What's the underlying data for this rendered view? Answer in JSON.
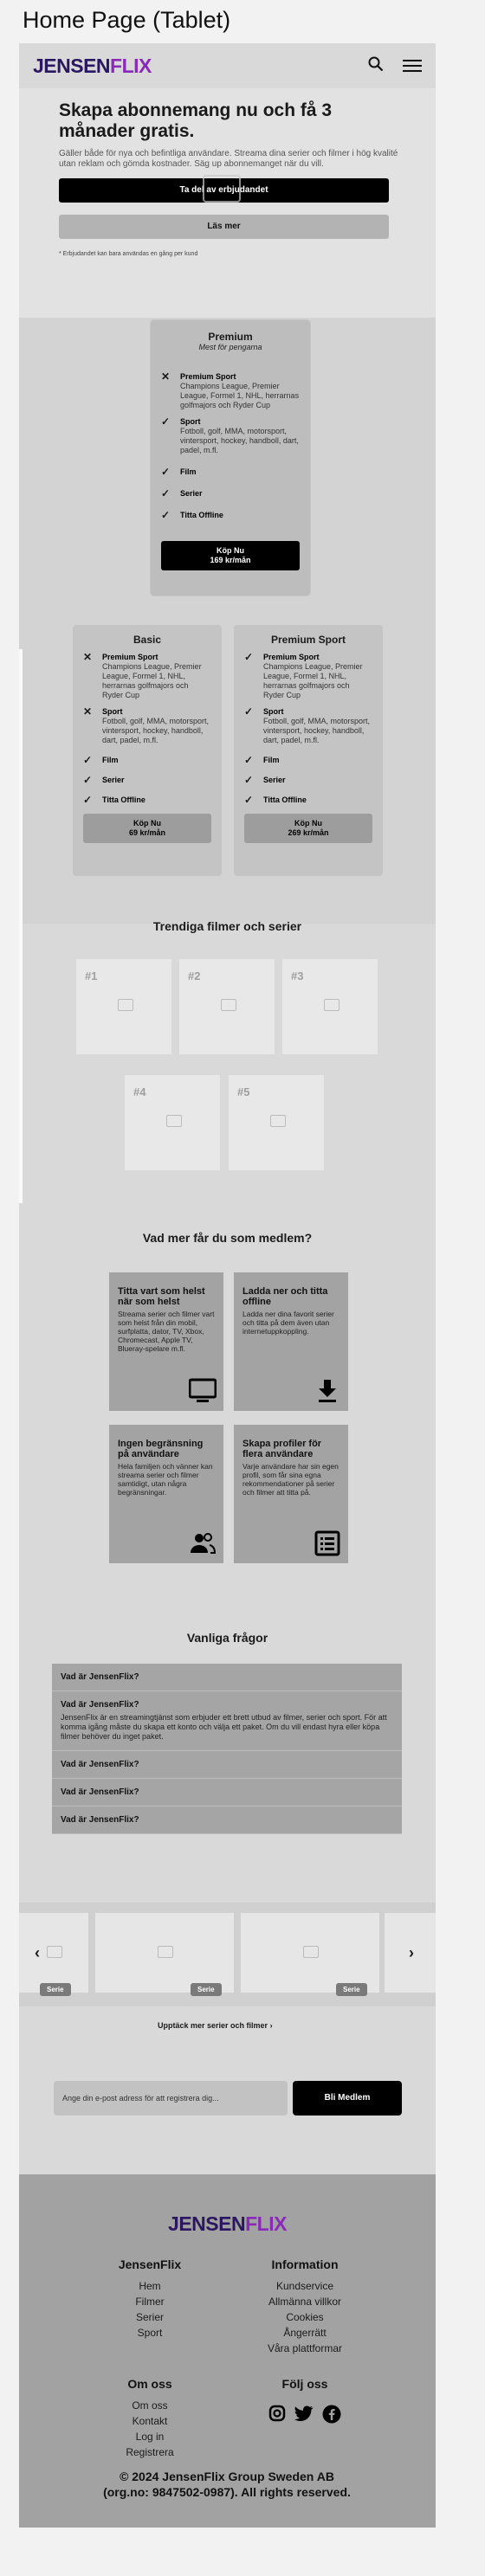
{
  "page_title": "Home Page (Tablet)",
  "header": {
    "logo_part1": "JENSEN",
    "logo_part2": "FLIX",
    "search_icon": "search-icon",
    "menu_icon": "hamburger-icon"
  },
  "hero": {
    "title": "Skapa abonnemang nu och få 3 månader gratis.",
    "subtitle": "Gäller både för nya och befintliga användare. Streama dina serier och filmer i hög kvalité utan reklam och gömda kostnader. Säg up abonnemanget när du vill.",
    "cta_primary": "Ta del av erbjudandet",
    "cta_secondary": "Läs mer",
    "fineprint": "* Erbjudandet kan bara användas en gång per kund"
  },
  "plans": {
    "featured": {
      "name": "Premium",
      "tagline": "Mest för pengarna",
      "features": [
        {
          "icon": "x-icon",
          "mark": "✕",
          "title": "Premium Sport",
          "desc": "Champions League, Premier League, Formel 1, NHL, herrarnas golfmajors och Ryder Cup"
        },
        {
          "icon": "check-icon",
          "mark": "✓",
          "title": "Sport",
          "desc": "Fotboll, golf, MMA, motorsport, vintersport, hockey, handboll, dart, padel, m.fl."
        },
        {
          "icon": "check-icon",
          "mark": "✓",
          "title": "Film",
          "desc": ""
        },
        {
          "icon": "check-icon",
          "mark": "✓",
          "title": "Serier",
          "desc": ""
        },
        {
          "icon": "check-icon",
          "mark": "✓",
          "title": "Titta Offline",
          "desc": ""
        }
      ],
      "button_line1": "Köp Nu",
      "button_line2": "169 kr/mån"
    },
    "basic": {
      "name": "Basic",
      "features": [
        {
          "icon": "x-icon",
          "mark": "✕",
          "title": "Premium Sport",
          "desc": "Champions League, Premier League, Formel 1, NHL, herrarnas golfmajors och Ryder Cup"
        },
        {
          "icon": "x-icon",
          "mark": "✕",
          "title": "Sport",
          "desc": "Fotboll, golf, MMA, motorsport, vintersport, hockey, handboll, dart, padel, m.fl."
        },
        {
          "icon": "check-icon",
          "mark": "✓",
          "title": "Film",
          "desc": ""
        },
        {
          "icon": "check-icon",
          "mark": "✓",
          "title": "Serier",
          "desc": ""
        },
        {
          "icon": "check-icon",
          "mark": "✓",
          "title": "Titta Offline",
          "desc": ""
        }
      ],
      "button_line1": "Köp Nu",
      "button_line2": "69 kr/mån"
    },
    "premium_sport": {
      "name": "Premium Sport",
      "features": [
        {
          "icon": "check-icon",
          "mark": "✓",
          "title": "Premium Sport",
          "desc": "Champions League, Premier League, Formel 1, NHL, herrarnas golfmajors och Ryder Cup"
        },
        {
          "icon": "check-icon",
          "mark": "✓",
          "title": "Sport",
          "desc": "Fotboll, golf, MMA, motorsport, vintersport, hockey, handboll, dart, padel, m.fl."
        },
        {
          "icon": "check-icon",
          "mark": "✓",
          "title": "Film",
          "desc": ""
        },
        {
          "icon": "check-icon",
          "mark": "✓",
          "title": "Serier",
          "desc": ""
        },
        {
          "icon": "check-icon",
          "mark": "✓",
          "title": "Titta Offline",
          "desc": ""
        }
      ],
      "button_line1": "Köp Nu",
      "button_line2": "269 kr/mån"
    }
  },
  "trending": {
    "title": "Trendiga filmer och serier",
    "ranks": [
      "#1",
      "#2",
      "#3",
      "#4",
      "#5"
    ]
  },
  "features": {
    "title": "Vad mer får du som medlem?",
    "items": [
      {
        "title": "Titta vart som helst när som helst",
        "desc": "Streama serier och filmer vart som helst från din mobil, surfplatta, dator, TV, Xbox, Chromecast, Apple TV, Blueray-spelare m.fl.",
        "icon": "tv-icon"
      },
      {
        "title": "Ladda ner och titta offline",
        "desc": "Ladda ner dina favorit serier och titta på dem även utan internetuppkoppling.",
        "icon": "download-icon"
      },
      {
        "title": "Ingen begränsning på användare",
        "desc": "Hela familjen och vänner kan streama serier och filmer samtidigt, utan några begränsningar.",
        "icon": "users-icon"
      },
      {
        "title": "Skapa profiler för flera användare",
        "desc": "Varje användare har sin egen profil, som får sina egna rekommendationer på serier och filmer att titta på.",
        "icon": "list-icon"
      }
    ]
  },
  "faq": {
    "title": "Vanliga frågor",
    "items": [
      {
        "q": "Vad är JensenFlix?",
        "a": ""
      },
      {
        "q": "Vad är JensenFlix?",
        "a": "JensenFlix är en streamingtjänst som erbjuder ett brett utbud av filmer, serier och sport. För att komma igång måste du skapa ett konto och välja ett paket. Om du vill endast hyra eller köpa filmer behöver du inget paket."
      },
      {
        "q": "Vad är JensenFlix?",
        "a": ""
      },
      {
        "q": "Vad är JensenFlix?",
        "a": ""
      },
      {
        "q": "Vad är JensenFlix?",
        "a": ""
      }
    ]
  },
  "carousel": {
    "tags": [
      "Serie",
      "Serie",
      "Serie"
    ],
    "discover_link": "Upptäck mer serier och filmer",
    "email_placeholder": "Ange din e-post adress för att registrera dig...",
    "join_button": "Bli Medlem"
  },
  "footer": {
    "logo_part1": "JENSEN",
    "logo_part2": "FLIX",
    "col1_title": "JensenFlix",
    "col1_links": [
      "Hem",
      "Filmer",
      "Serier",
      "Sport"
    ],
    "col2_title": "Information",
    "col2_links": [
      "Kundservice",
      "Allmänna villkor",
      "Cookies",
      "Ångerrätt",
      "Våra plattformar"
    ],
    "col3_title": "Om oss",
    "col3_links": [
      "Om oss",
      "Kontakt",
      "Log in",
      "Registrera"
    ],
    "col4_title": "Följ oss",
    "social": [
      "instagram-icon",
      "twitter-icon",
      "facebook-icon"
    ],
    "copyright": "© 2024 JensenFlix Group Sweden AB (org.no: 9847502-0987). All rights reserved."
  }
}
